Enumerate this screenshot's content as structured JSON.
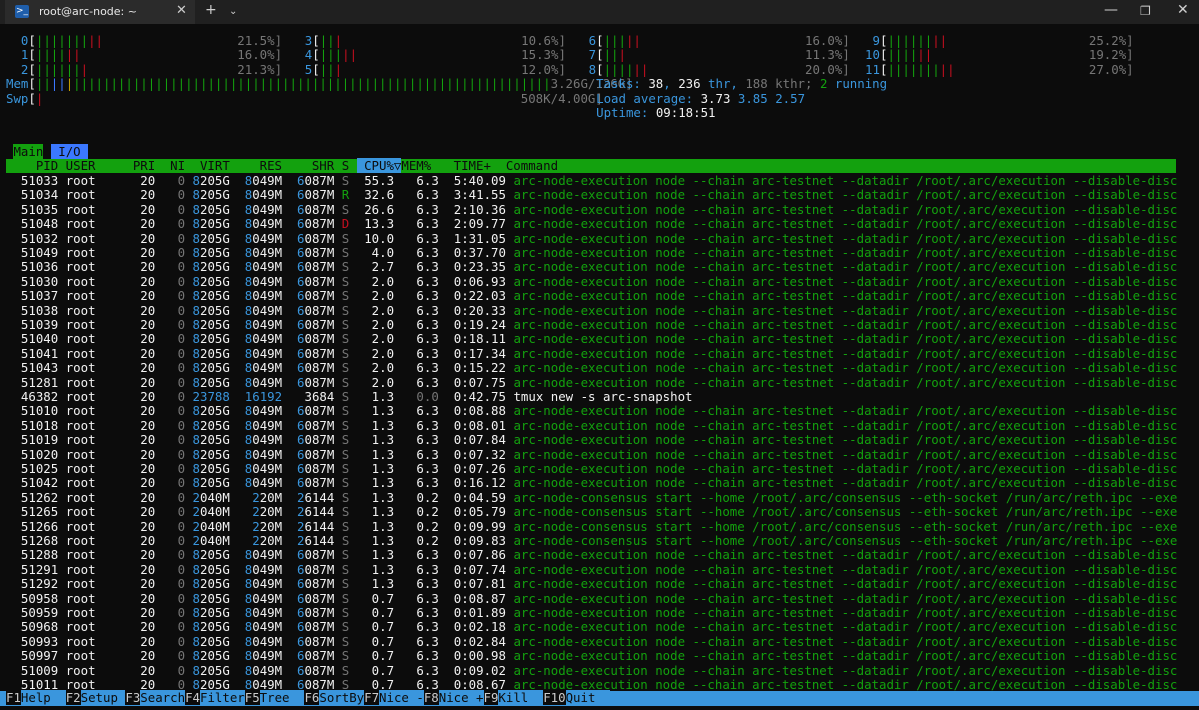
{
  "window": {
    "tab_title": "root@arc-node: ~"
  },
  "cpu_meters": [
    {
      "id": "0",
      "pct": "21.5%]",
      "bars": [
        [
          "g",
          "|||||||"
        ],
        [
          "r",
          "||"
        ]
      ]
    },
    {
      "id": "1",
      "pct": "16.0%]",
      "bars": [
        [
          "g",
          "||||"
        ],
        [
          "r",
          "||"
        ]
      ]
    },
    {
      "id": "2",
      "pct": "21.3%]",
      "bars": [
        [
          "g",
          "||||||"
        ],
        [
          "r",
          "|"
        ]
      ]
    },
    {
      "id": "3",
      "pct": "10.6%]",
      "bars": [
        [
          "g",
          "||"
        ],
        [
          "r",
          "|"
        ]
      ]
    },
    {
      "id": "4",
      "pct": "15.3%]",
      "bars": [
        [
          "g",
          "|||"
        ],
        [
          "r",
          "||"
        ]
      ]
    },
    {
      "id": "5",
      "pct": "12.0%]",
      "bars": [
        [
          "g",
          "||"
        ],
        [
          "r",
          "|"
        ]
      ]
    },
    {
      "id": "6",
      "pct": "16.0%]",
      "bars": [
        [
          "g",
          "|||"
        ],
        [
          "r",
          "||"
        ]
      ]
    },
    {
      "id": "7",
      "pct": "11.3%]",
      "bars": [
        [
          "g",
          "||"
        ],
        [
          "r",
          "|"
        ]
      ]
    },
    {
      "id": "8",
      "pct": "20.0%]",
      "bars": [
        [
          "g",
          "||||"
        ],
        [
          "r",
          "||"
        ]
      ]
    },
    {
      "id": "9",
      "pct": "25.2%]",
      "bars": [
        [
          "g",
          "||||||"
        ],
        [
          "r",
          "||"
        ]
      ]
    },
    {
      "id": "10",
      "pct": "19.2%]",
      "bars": [
        [
          "g",
          "||||"
        ],
        [
          "r",
          "||"
        ]
      ]
    },
    {
      "id": "11",
      "pct": "27.0%]",
      "bars": [
        [
          "g",
          "|||||||"
        ],
        [
          "r",
          "||"
        ]
      ]
    }
  ],
  "mem": {
    "label": "Mem",
    "value": "3.26G/126G]"
  },
  "swp": {
    "label": "Swp",
    "value": "508K/4.00G]"
  },
  "tasks": {
    "label": "Tasks:",
    "tasks": "38",
    "thr": "236",
    "thr_lbl": "thr,",
    "kthr": "188 kthr;",
    "running": "2",
    "running_lbl": "running"
  },
  "load": {
    "label": "Load average:",
    "l1": "3.73",
    "l5": "3.85",
    "l15": "2.57"
  },
  "uptime": {
    "label": "Uptime:",
    "value": "09:18:51"
  },
  "tabs": {
    "main": "Main",
    "io": "I/O"
  },
  "columns": {
    "pid": "PID",
    "user": "USER",
    "pri": "PRI",
    "ni": "NI",
    "virt": "VIRT",
    "res": "RES",
    "shr": "SHR",
    "s": "S",
    "cpu": "CPU%▽",
    "mem": "MEM%",
    "time": "TIME+",
    "cmd": "Command"
  },
  "commands": {
    "exec": "arc-node-execution node --chain arc-testnet --datadir /root/.arc/execution --disable-disc",
    "cons": "arc-node-consensus start --home /root/.arc/consensus --eth-socket /run/arc/reth.ipc --exe",
    "tmux": "tmux new -s arc-snapshot"
  },
  "processes": [
    [
      "51033",
      "root",
      "20",
      "0",
      "8205G",
      "8049M",
      "6087M",
      "S",
      "55.3",
      "6.3",
      "5:40.09",
      "exec"
    ],
    [
      "51034",
      "root",
      "20",
      "0",
      "8205G",
      "8049M",
      "6087M",
      "R",
      "32.6",
      "6.3",
      "3:41.55",
      "exec"
    ],
    [
      "51035",
      "root",
      "20",
      "0",
      "8205G",
      "8049M",
      "6087M",
      "S",
      "26.6",
      "6.3",
      "2:10.36",
      "exec"
    ],
    [
      "51048",
      "root",
      "20",
      "0",
      "8205G",
      "8049M",
      "6087M",
      "D",
      "13.3",
      "6.3",
      "2:09.77",
      "exec"
    ],
    [
      "51032",
      "root",
      "20",
      "0",
      "8205G",
      "8049M",
      "6087M",
      "S",
      "10.0",
      "6.3",
      "1:31.05",
      "exec"
    ],
    [
      "51049",
      "root",
      "20",
      "0",
      "8205G",
      "8049M",
      "6087M",
      "S",
      "4.0",
      "6.3",
      "0:37.70",
      "exec"
    ],
    [
      "51036",
      "root",
      "20",
      "0",
      "8205G",
      "8049M",
      "6087M",
      "S",
      "2.7",
      "6.3",
      "0:23.35",
      "exec"
    ],
    [
      "51030",
      "root",
      "20",
      "0",
      "8205G",
      "8049M",
      "6087M",
      "S",
      "2.0",
      "6.3",
      "0:06.93",
      "exec"
    ],
    [
      "51037",
      "root",
      "20",
      "0",
      "8205G",
      "8049M",
      "6087M",
      "S",
      "2.0",
      "6.3",
      "0:22.03",
      "exec"
    ],
    [
      "51038",
      "root",
      "20",
      "0",
      "8205G",
      "8049M",
      "6087M",
      "S",
      "2.0",
      "6.3",
      "0:20.33",
      "exec"
    ],
    [
      "51039",
      "root",
      "20",
      "0",
      "8205G",
      "8049M",
      "6087M",
      "S",
      "2.0",
      "6.3",
      "0:19.24",
      "exec"
    ],
    [
      "51040",
      "root",
      "20",
      "0",
      "8205G",
      "8049M",
      "6087M",
      "S",
      "2.0",
      "6.3",
      "0:18.11",
      "exec"
    ],
    [
      "51041",
      "root",
      "20",
      "0",
      "8205G",
      "8049M",
      "6087M",
      "S",
      "2.0",
      "6.3",
      "0:17.34",
      "exec"
    ],
    [
      "51043",
      "root",
      "20",
      "0",
      "8205G",
      "8049M",
      "6087M",
      "S",
      "2.0",
      "6.3",
      "0:15.22",
      "exec"
    ],
    [
      "51281",
      "root",
      "20",
      "0",
      "8205G",
      "8049M",
      "6087M",
      "S",
      "2.0",
      "6.3",
      "0:07.75",
      "exec"
    ],
    [
      "46382",
      "root",
      "20",
      "0",
      "23788",
      "16192",
      "3684",
      "S",
      "1.3",
      "0.0",
      "0:42.75",
      "tmux"
    ],
    [
      "51010",
      "root",
      "20",
      "0",
      "8205G",
      "8049M",
      "6087M",
      "S",
      "1.3",
      "6.3",
      "0:08.88",
      "exec"
    ],
    [
      "51018",
      "root",
      "20",
      "0",
      "8205G",
      "8049M",
      "6087M",
      "S",
      "1.3",
      "6.3",
      "0:08.01",
      "exec"
    ],
    [
      "51019",
      "root",
      "20",
      "0",
      "8205G",
      "8049M",
      "6087M",
      "S",
      "1.3",
      "6.3",
      "0:07.84",
      "exec"
    ],
    [
      "51020",
      "root",
      "20",
      "0",
      "8205G",
      "8049M",
      "6087M",
      "S",
      "1.3",
      "6.3",
      "0:07.32",
      "exec"
    ],
    [
      "51025",
      "root",
      "20",
      "0",
      "8205G",
      "8049M",
      "6087M",
      "S",
      "1.3",
      "6.3",
      "0:07.26",
      "exec"
    ],
    [
      "51042",
      "root",
      "20",
      "0",
      "8205G",
      "8049M",
      "6087M",
      "S",
      "1.3",
      "6.3",
      "0:16.12",
      "exec"
    ],
    [
      "51262",
      "root",
      "20",
      "0",
      "2040M",
      "220M",
      "26144",
      "S",
      "1.3",
      "0.2",
      "0:04.59",
      "cons"
    ],
    [
      "51265",
      "root",
      "20",
      "0",
      "2040M",
      "220M",
      "26144",
      "S",
      "1.3",
      "0.2",
      "0:05.79",
      "cons"
    ],
    [
      "51266",
      "root",
      "20",
      "0",
      "2040M",
      "220M",
      "26144",
      "S",
      "1.3",
      "0.2",
      "0:09.99",
      "cons"
    ],
    [
      "51268",
      "root",
      "20",
      "0",
      "2040M",
      "220M",
      "26144",
      "S",
      "1.3",
      "0.2",
      "0:09.83",
      "cons"
    ],
    [
      "51288",
      "root",
      "20",
      "0",
      "8205G",
      "8049M",
      "6087M",
      "S",
      "1.3",
      "6.3",
      "0:07.86",
      "exec"
    ],
    [
      "51291",
      "root",
      "20",
      "0",
      "8205G",
      "8049M",
      "6087M",
      "S",
      "1.3",
      "6.3",
      "0:07.74",
      "exec"
    ],
    [
      "51292",
      "root",
      "20",
      "0",
      "8205G",
      "8049M",
      "6087M",
      "S",
      "1.3",
      "6.3",
      "0:07.81",
      "exec"
    ],
    [
      "50958",
      "root",
      "20",
      "0",
      "8205G",
      "8049M",
      "6087M",
      "S",
      "0.7",
      "6.3",
      "0:08.87",
      "exec"
    ],
    [
      "50959",
      "root",
      "20",
      "0",
      "8205G",
      "8049M",
      "6087M",
      "S",
      "0.7",
      "6.3",
      "0:01.89",
      "exec"
    ],
    [
      "50968",
      "root",
      "20",
      "0",
      "8205G",
      "8049M",
      "6087M",
      "S",
      "0.7",
      "6.3",
      "0:02.18",
      "exec"
    ],
    [
      "50993",
      "root",
      "20",
      "0",
      "8205G",
      "8049M",
      "6087M",
      "S",
      "0.7",
      "6.3",
      "0:02.84",
      "exec"
    ],
    [
      "50997",
      "root",
      "20",
      "0",
      "8205G",
      "8049M",
      "6087M",
      "S",
      "0.7",
      "6.3",
      "0:00.98",
      "exec"
    ],
    [
      "51009",
      "root",
      "20",
      "0",
      "8205G",
      "8049M",
      "6087M",
      "S",
      "0.7",
      "6.3",
      "0:09.02",
      "exec"
    ],
    [
      "51011",
      "root",
      "20",
      "0",
      "8205G",
      "8049M",
      "6087M",
      "S",
      "0.7",
      "6.3",
      "0:08.67",
      "exec"
    ]
  ],
  "fkeys": [
    [
      "F1",
      "Help  "
    ],
    [
      "F2",
      "Setup "
    ],
    [
      "F3",
      "Search"
    ],
    [
      "F4",
      "Filter"
    ],
    [
      "F5",
      "Tree  "
    ],
    [
      "F6",
      "SortBy"
    ],
    [
      "F7",
      "Nice -"
    ],
    [
      "F8",
      "Nice +"
    ],
    [
      "F9",
      "Kill  "
    ],
    [
      "F10",
      "Quit  "
    ]
  ]
}
